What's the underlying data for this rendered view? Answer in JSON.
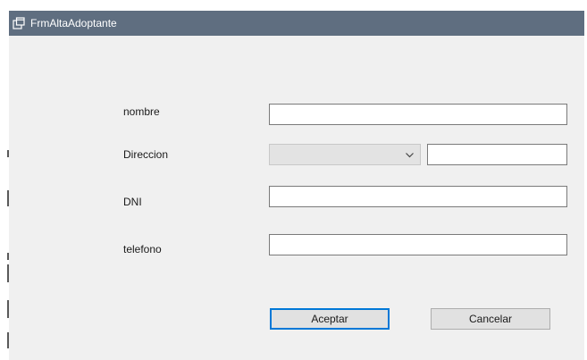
{
  "window": {
    "title": "FrmAltaAdoptante",
    "icon": "window-form-icon"
  },
  "form": {
    "nombre_label": "nombre",
    "nombre_value": "",
    "direccion_label": "Direccion",
    "direccion_selected": "",
    "direccion_value": "",
    "dni_label": "DNI",
    "dni_value": "",
    "telefono_label": "telefono",
    "telefono_value": ""
  },
  "buttons": {
    "accept_label": "Aceptar",
    "cancel_label": "Cancelar"
  },
  "colors": {
    "titlebar": "#5f6e80",
    "form_background": "#f0f0f0",
    "default_button_border": "#0078d7"
  }
}
